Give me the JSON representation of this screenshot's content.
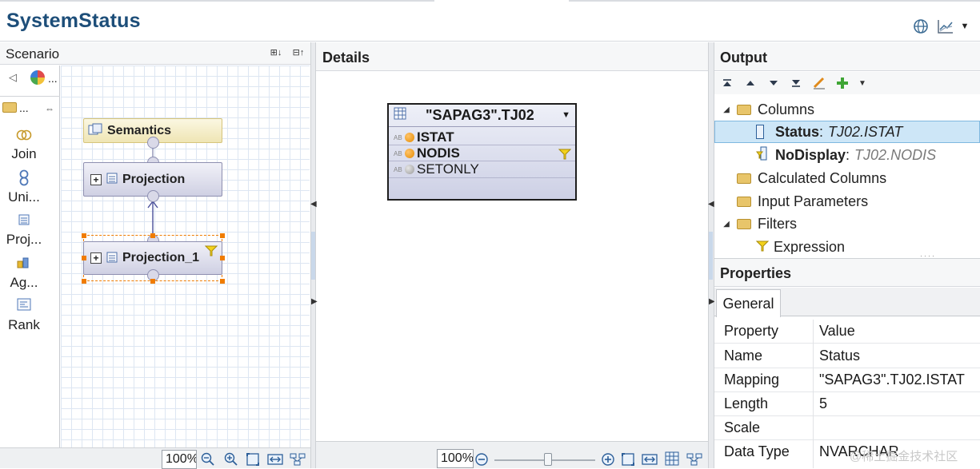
{
  "app": {
    "title": "SystemStatus"
  },
  "top_icons": [
    "globe-icon",
    "chart-icon",
    "dropdown-icon"
  ],
  "scenario": {
    "title": "Scenario",
    "palette": [
      {
        "label": "Join",
        "icon": "join-icon"
      },
      {
        "label": "Uni...",
        "icon": "union-icon"
      },
      {
        "label": "Proj...",
        "icon": "projection-icon"
      },
      {
        "label": "Ag...",
        "icon": "aggregation-icon"
      },
      {
        "label": "Rank",
        "icon": "rank-icon"
      }
    ],
    "palette_top": {
      "more_label": "...",
      "folder_label": "..."
    },
    "nodes": {
      "semantics": "Semantics",
      "projection": "Projection",
      "projection_1": "Projection_1"
    },
    "footer": {
      "zoom": "100%"
    }
  },
  "details": {
    "title": "Details",
    "table": {
      "name": "\"SAPAG3\".TJ02",
      "columns": [
        {
          "type": "AB",
          "name": "ISTAT",
          "selected": true
        },
        {
          "type": "AB",
          "name": "NODIS",
          "selected": true,
          "filtered": true
        },
        {
          "type": "AB",
          "name": "SETONLY",
          "selected": false
        }
      ]
    },
    "footer": {
      "zoom": "100%"
    }
  },
  "output": {
    "title": "Output",
    "tree": {
      "columns_label": "Columns",
      "columns": [
        {
          "name": "Status",
          "mapping": "TJ02.ISTAT",
          "selected": true
        },
        {
          "name": "NoDisplay",
          "mapping": "TJ02.NODIS",
          "selected": false
        }
      ],
      "calculated_label": "Calculated Columns",
      "input_params_label": "Input Parameters",
      "filters_label": "Filters",
      "expression_label": "Expression"
    }
  },
  "properties": {
    "title": "Properties",
    "tab": "General",
    "headers": {
      "property": "Property",
      "value": "Value"
    },
    "rows": [
      {
        "key": "Name",
        "value": "Status"
      },
      {
        "key": "Mapping",
        "value": "\"SAPAG3\".TJ02.ISTAT"
      },
      {
        "key": "Length",
        "value": "5"
      },
      {
        "key": "Scale",
        "value": ""
      },
      {
        "key": "Data Type",
        "value": "NVARCHAR"
      }
    ]
  },
  "watermark": "@稀土掘金技术社区",
  "colors": {
    "title": "#1d4e79",
    "selection": "#cde6f7",
    "accent": "#f07c00"
  }
}
